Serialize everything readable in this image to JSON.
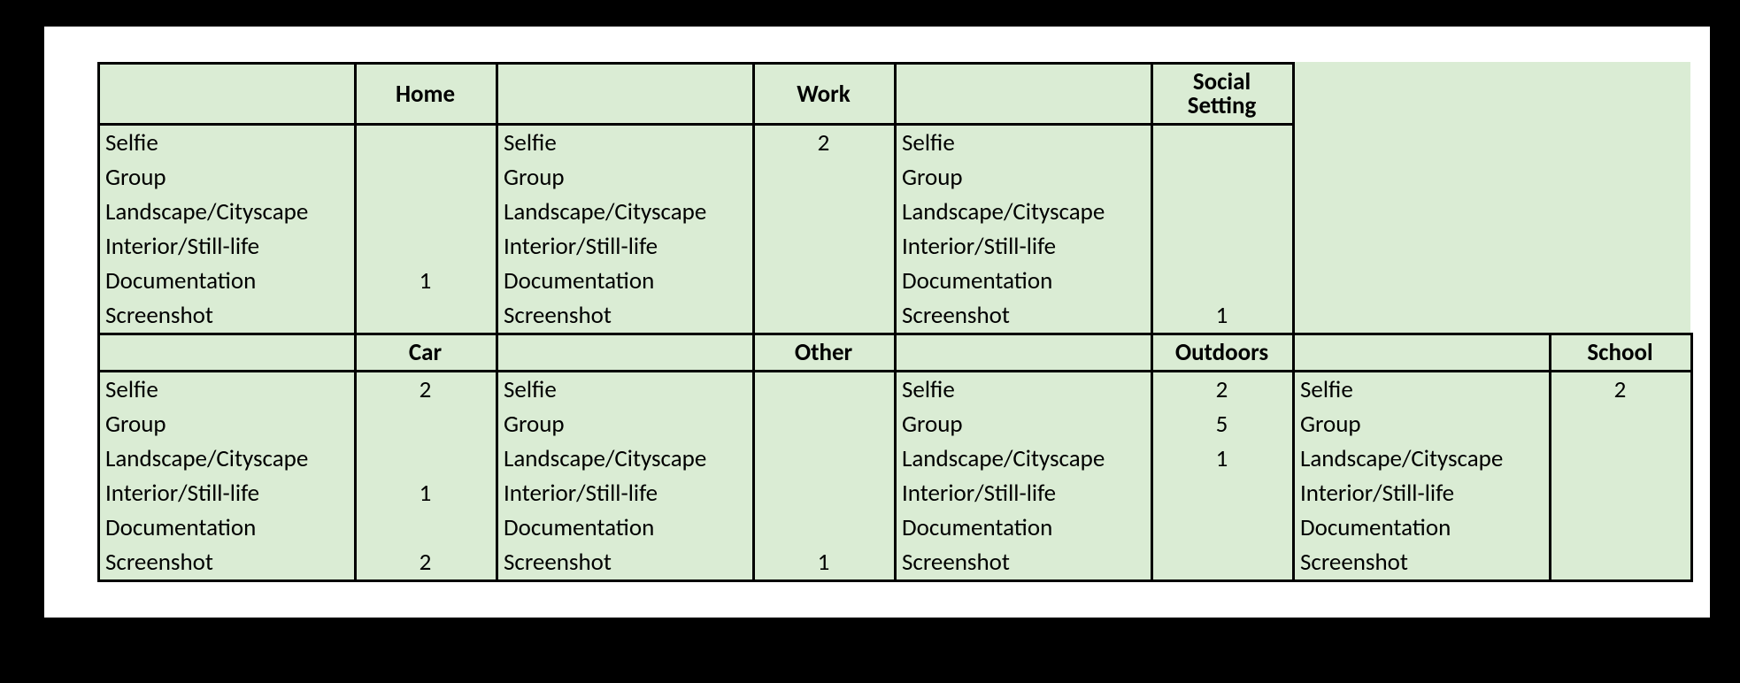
{
  "categories": {
    "c0": "Selfie",
    "c1": "Group",
    "c2": "Landscape/Cityscape",
    "c3": "Interior/Still-life",
    "c4": "Documentation",
    "c5": "Screenshot"
  },
  "top": {
    "home": {
      "label": "Home",
      "values": [
        "",
        "",
        "",
        "",
        "1",
        ""
      ]
    },
    "work": {
      "label": "Work",
      "values": [
        "2",
        "",
        "",
        "",
        "",
        ""
      ]
    },
    "social": {
      "label": "Social Setting",
      "values": [
        "",
        "",
        "",
        "",
        "",
        "1"
      ]
    }
  },
  "bottom": {
    "car": {
      "label": "Car",
      "values": [
        "2",
        "",
        "",
        "1",
        "",
        "2"
      ]
    },
    "other": {
      "label": "Other",
      "values": [
        "",
        "",
        "",
        "",
        "",
        "1"
      ]
    },
    "outdoors": {
      "label": "Outdoors",
      "values": [
        "2",
        "5",
        "1",
        "",
        "",
        ""
      ]
    },
    "school": {
      "label": "School",
      "values": [
        "2",
        "",
        "",
        "",
        "",
        ""
      ]
    }
  },
  "chart_data": {
    "type": "table",
    "title": "",
    "row_categories": [
      "Selfie",
      "Group",
      "Landscape/Cityscape",
      "Interior/Still-life",
      "Documentation",
      "Screenshot"
    ],
    "columns": [
      "Home",
      "Work",
      "Social Setting",
      "Car",
      "Other",
      "Outdoors",
      "School"
    ],
    "matrix": [
      [
        null,
        2,
        null,
        2,
        null,
        2,
        2
      ],
      [
        null,
        null,
        null,
        null,
        null,
        5,
        null
      ],
      [
        null,
        null,
        null,
        null,
        null,
        1,
        null
      ],
      [
        null,
        null,
        null,
        1,
        null,
        null,
        null
      ],
      [
        1,
        null,
        null,
        null,
        null,
        null,
        null
      ],
      [
        null,
        null,
        1,
        2,
        1,
        null,
        null
      ]
    ]
  }
}
